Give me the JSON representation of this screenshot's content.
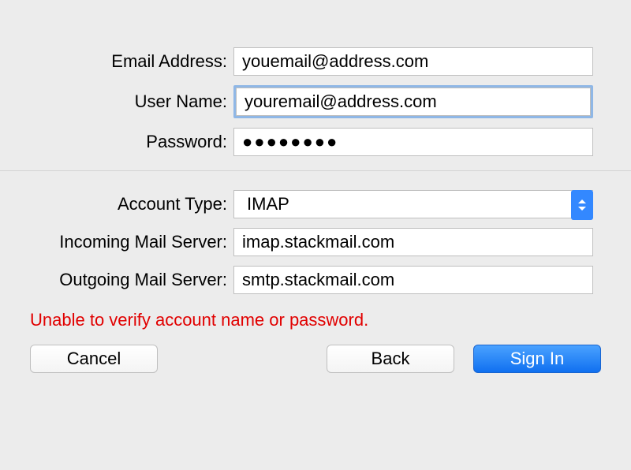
{
  "fields": {
    "email_label": "Email Address:",
    "email_value": "youemail@address.com",
    "username_label": "User Name:",
    "username_value": "youremail@address.com",
    "password_label": "Password:",
    "password_value": "●●●●●●●●",
    "account_type_label": "Account Type:",
    "account_type_value": "IMAP",
    "incoming_label": "Incoming Mail Server:",
    "incoming_value": "imap.stackmail.com",
    "outgoing_label": "Outgoing Mail Server:",
    "outgoing_value": "smtp.stackmail.com"
  },
  "error_message": "Unable to verify account name or password.",
  "buttons": {
    "cancel": "Cancel",
    "back": "Back",
    "signin": "Sign In"
  }
}
